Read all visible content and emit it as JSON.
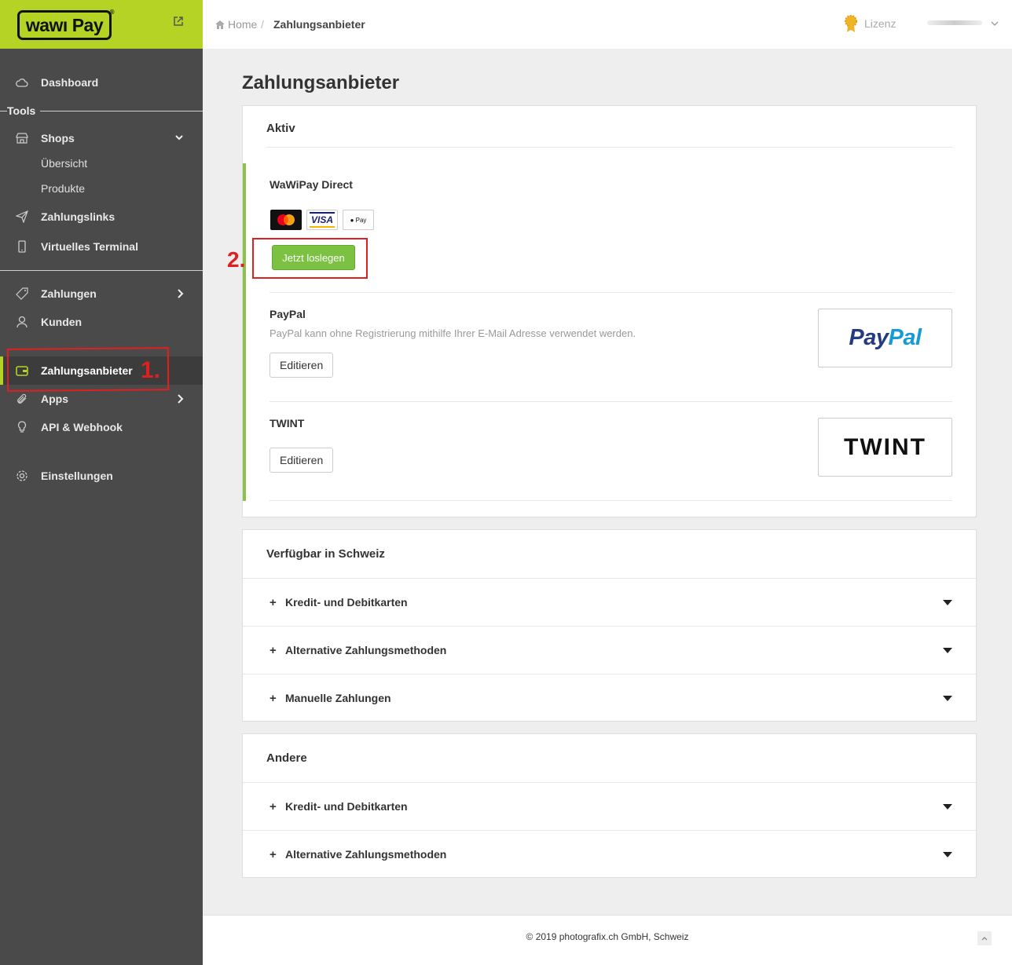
{
  "brand": {
    "logo_text": "wawı Pay"
  },
  "sidebar": {
    "dashboard": "Dashboard",
    "tools_label": "Tools",
    "shops": "Shops",
    "shops_sub": [
      "Übersicht",
      "Produkte"
    ],
    "zahlungslinks": "Zahlungslinks",
    "virtuelles_terminal": "Virtuelles Terminal",
    "zahlungen": "Zahlungen",
    "kunden": "Kunden",
    "zahlungsanbieter": "Zahlungsanbieter",
    "apps": "Apps",
    "api_webhook": "API & Webhook",
    "einstellungen": "Einstellungen"
  },
  "annotations": {
    "step1": "1.",
    "step2": "2."
  },
  "header": {
    "breadcrumb_home": "Home",
    "breadcrumb_sep": "/",
    "breadcrumb_current": "Zahlungsanbieter",
    "lizenz": "Lizenz"
  },
  "page_title": "Zahlungsanbieter",
  "aktiv": {
    "title": "Aktiv",
    "wawipay": {
      "name": "WaWiPay Direct",
      "cards": [
        "mastercard",
        "VISA",
        "Pay"
      ],
      "button": "Jetzt loslegen"
    },
    "paypal": {
      "name": "PayPal",
      "description": "PayPal kann ohne Registrierung mithilfe Ihrer E-Mail Adresse verwendet werden.",
      "button": "Editieren",
      "logo_a": "Pay",
      "logo_b": "Pal"
    },
    "twint": {
      "name": "TWINT",
      "button": "Editieren",
      "logo": "TWINT"
    }
  },
  "schweiz": {
    "title": "Verfügbar in Schweiz",
    "rows": [
      "Kredit- und Debitkarten",
      "Alternative Zahlungsmethoden",
      "Manuelle Zahlungen"
    ]
  },
  "andere": {
    "title": "Andere",
    "rows": [
      "Kredit- und Debitkarten",
      "Alternative Zahlungsmethoden"
    ]
  },
  "accordion_plus": "+",
  "footer": {
    "copyright": "© 2019 photografix.ch GmbH, Schweiz"
  },
  "colors": {
    "brand_lime": "#b5d324",
    "sidebar_bg": "#4a4a4a",
    "accent_green": "#7cc242",
    "annotation_red": "#e02020"
  }
}
